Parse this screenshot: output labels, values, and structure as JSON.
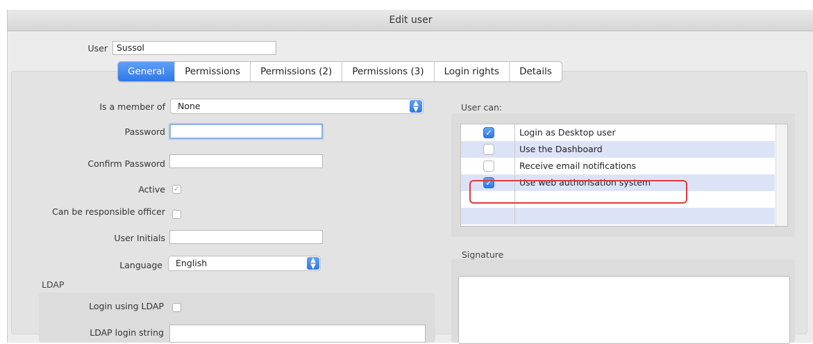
{
  "window": {
    "title": "Edit user"
  },
  "user": {
    "label": "User",
    "value": "Sussol"
  },
  "tabs": [
    {
      "label": "General",
      "active": true
    },
    {
      "label": "Permissions"
    },
    {
      "label": "Permissions (2)"
    },
    {
      "label": "Permissions (3)"
    },
    {
      "label": "Login rights"
    },
    {
      "label": "Details"
    }
  ],
  "general": {
    "member_of_label": "Is a member of",
    "member_of_value": "None",
    "password_label": "Password",
    "confirm_password_label": "Confirm Password",
    "active_label": "Active",
    "active_checked": true,
    "responsible_label": "Can be responsible officer",
    "responsible_checked": false,
    "initials_label": "User Initials",
    "language_label": "Language",
    "language_value": "English",
    "ldap_title": "LDAP",
    "ldap_login_label": "Login using LDAP",
    "ldap_string_label": "LDAP login string"
  },
  "user_can": {
    "title": "User can:",
    "items": [
      {
        "label": "Login as Desktop user",
        "checked": true
      },
      {
        "label": "Use the Dashboard",
        "checked": false
      },
      {
        "label": "Receive email notifications",
        "checked": false
      },
      {
        "label": "Use web authorisation system",
        "checked": true
      }
    ]
  },
  "signature": {
    "title": "Signature"
  },
  "colors": {
    "accent": "#2f78e8",
    "highlight": "#e03a3a",
    "alt_row": "#dde3f7"
  }
}
